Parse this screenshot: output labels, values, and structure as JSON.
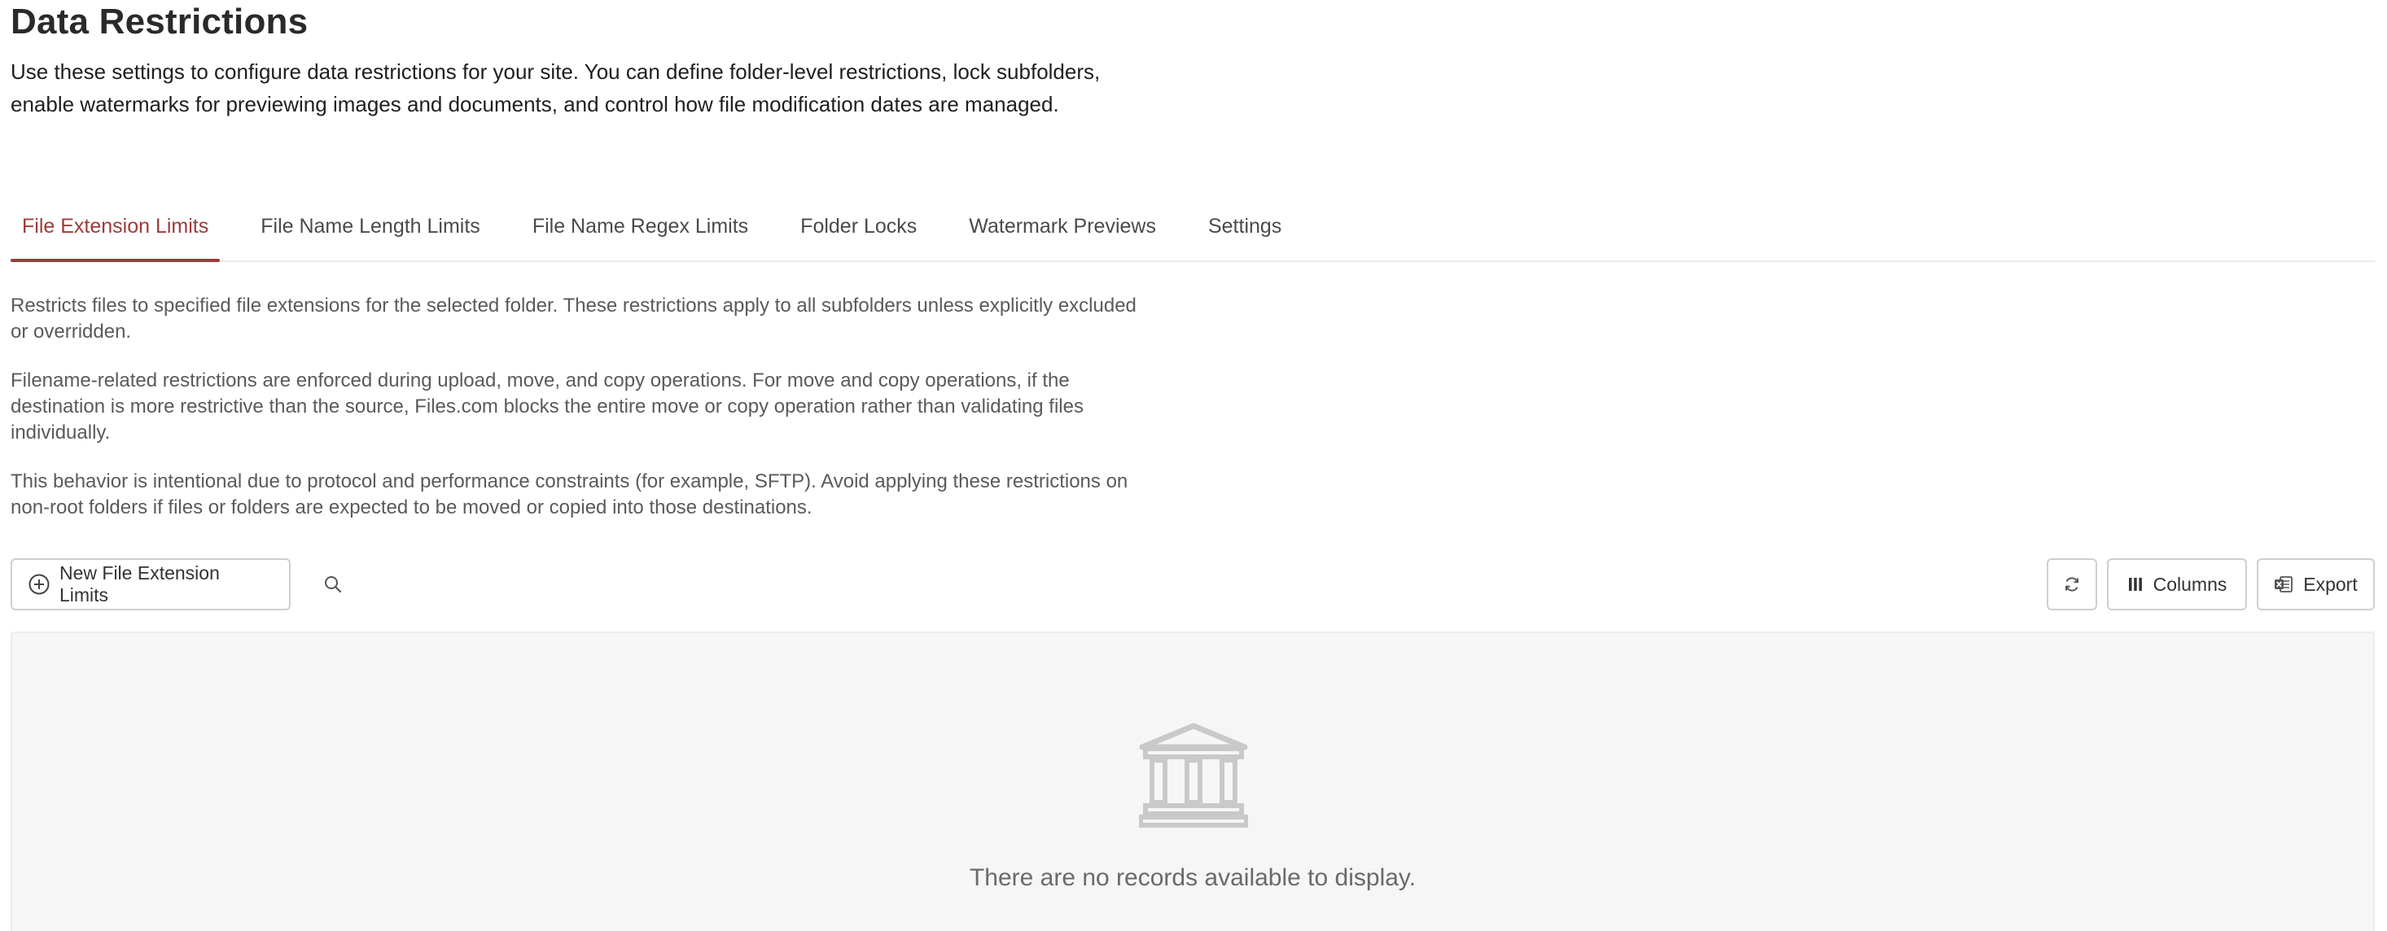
{
  "header": {
    "title": "Data Restrictions",
    "intro": "Use these settings to configure data restrictions for your site. You can define folder-level restrictions, lock subfolders, enable watermarks for previewing images and documents, and control how file modification dates are managed."
  },
  "tabs": [
    {
      "label": "File Extension Limits",
      "active": true
    },
    {
      "label": "File Name Length Limits",
      "active": false
    },
    {
      "label": "File Name Regex Limits",
      "active": false
    },
    {
      "label": "Folder Locks",
      "active": false
    },
    {
      "label": "Watermark Previews",
      "active": false
    },
    {
      "label": "Settings",
      "active": false
    }
  ],
  "description": [
    "Restricts files to specified file extensions for the selected folder. These restrictions apply to all subfolders unless explicitly excluded or overridden.",
    "Filename-related restrictions are enforced during upload, move, and copy operations. For move and copy operations, if the destination is more restrictive than the source, Files.com blocks the entire move or copy operation rather than validating files individually.",
    "This behavior is intentional due to protocol and performance constraints (for example, SFTP). Avoid applying these restrictions on non-root folders if files or folders are expected to be moved or copied into those destinations."
  ],
  "toolbar": {
    "new_label": "New File Extension Limits",
    "new_icon": "plus-circle-icon",
    "search_icon": "search-icon",
    "refresh_icon": "refresh-icon",
    "columns_label": "Columns",
    "columns_icon": "columns-icon",
    "export_label": "Export",
    "export_icon": "excel-export-icon"
  },
  "empty_state": {
    "icon": "bank-building-icon",
    "message": "There are no records available to display."
  },
  "colors": {
    "accent": "#9e3b3b",
    "border": "#cfcfcf",
    "empty_bg": "#f6f6f6"
  }
}
